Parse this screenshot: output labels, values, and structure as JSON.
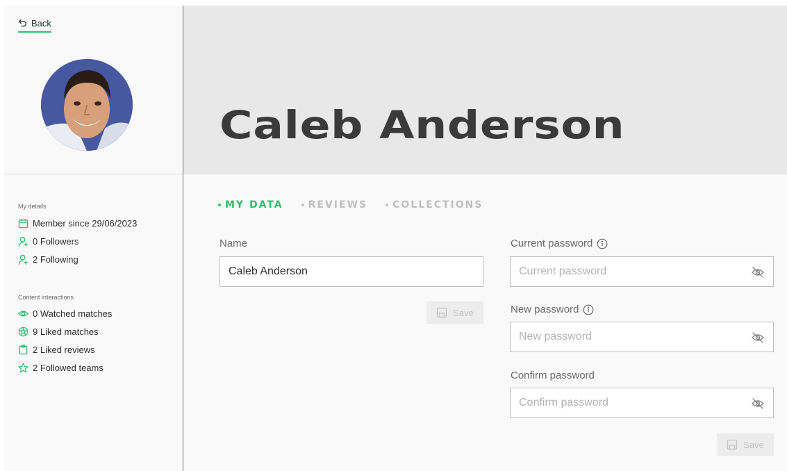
{
  "nav": {
    "back_label": "Back"
  },
  "profile": {
    "name": "Caleb Anderson"
  },
  "sidebar": {
    "details_label": "My details",
    "details": [
      {
        "icon": "calendar-icon",
        "text": "Member since 29/06/2023"
      },
      {
        "icon": "user-plus-icon",
        "text": "0 Followers"
      },
      {
        "icon": "user-plus-icon",
        "text": "2 Following"
      }
    ],
    "interactions_label": "Content interactions",
    "interactions": [
      {
        "icon": "eye-icon",
        "text": "0 Watched matches"
      },
      {
        "icon": "soccer-ball-icon",
        "text": "9 Liked matches"
      },
      {
        "icon": "clipboard-icon",
        "text": "2 Liked reviews"
      },
      {
        "icon": "star-icon",
        "text": "2 Followed teams"
      }
    ]
  },
  "tabs": [
    {
      "label": "MY DATA",
      "active": true
    },
    {
      "label": "REVIEWS",
      "active": false
    },
    {
      "label": "COLLECTIONS",
      "active": false
    }
  ],
  "form": {
    "name_label": "Name",
    "name_value": "Caleb Anderson",
    "save_label": "Save",
    "current_password_label": "Current password",
    "current_password_placeholder": "Current password",
    "new_password_label": "New password",
    "new_password_placeholder": "New password",
    "confirm_password_label": "Confirm password",
    "confirm_password_placeholder": "Confirm password",
    "password_save_label": "Save"
  },
  "colors": {
    "accent": "#2fbf6b",
    "header_bg": "#e8e8e8",
    "tab_inactive": "#bfbfbf"
  }
}
